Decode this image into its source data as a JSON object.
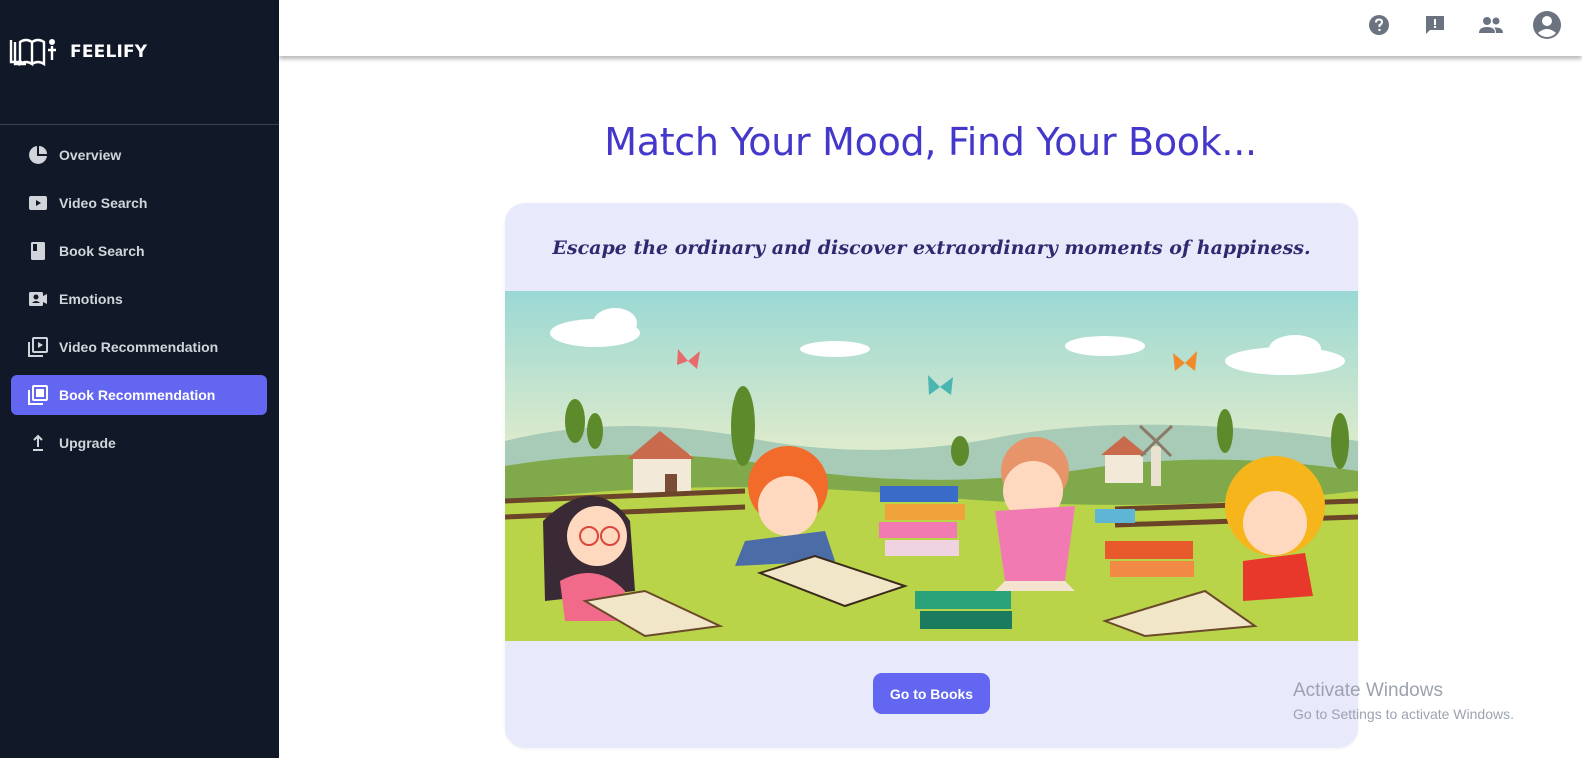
{
  "brand": {
    "name": "FEELIFY",
    "logo_icon": "book-person-icon"
  },
  "sidebar": {
    "items": [
      {
        "label": "Overview",
        "icon": "pie-chart-icon",
        "active": false
      },
      {
        "label": "Video Search",
        "icon": "video-icon",
        "active": false
      },
      {
        "label": "Book Search",
        "icon": "book-icon",
        "active": false
      },
      {
        "label": "Emotions",
        "icon": "contact-camera-icon",
        "active": false
      },
      {
        "label": "Video Recommendation",
        "icon": "video-library-icon",
        "active": false
      },
      {
        "label": "Book Recommendation",
        "icon": "library-books-icon",
        "active": true
      },
      {
        "label": "Upgrade",
        "icon": "upload-arrow-icon",
        "active": false
      }
    ]
  },
  "topbar": {
    "icons": [
      "help-icon",
      "feedback-icon",
      "people-icon",
      "account-icon"
    ]
  },
  "main": {
    "title": "Match Your Mood, Find Your Book...",
    "tagline": "Escape the ordinary and discover extraordinary moments of happiness.",
    "cta_label": "Go to Books",
    "illustration": "children-reading-books-in-meadow"
  },
  "watermark": {
    "line1": "Activate Windows",
    "line2": "Go to Settings to activate Windows."
  },
  "colors": {
    "sidebar_bg": "#111827",
    "accent": "#6366f1",
    "title": "#4338ca",
    "card_bg": "#e8e9fb"
  }
}
